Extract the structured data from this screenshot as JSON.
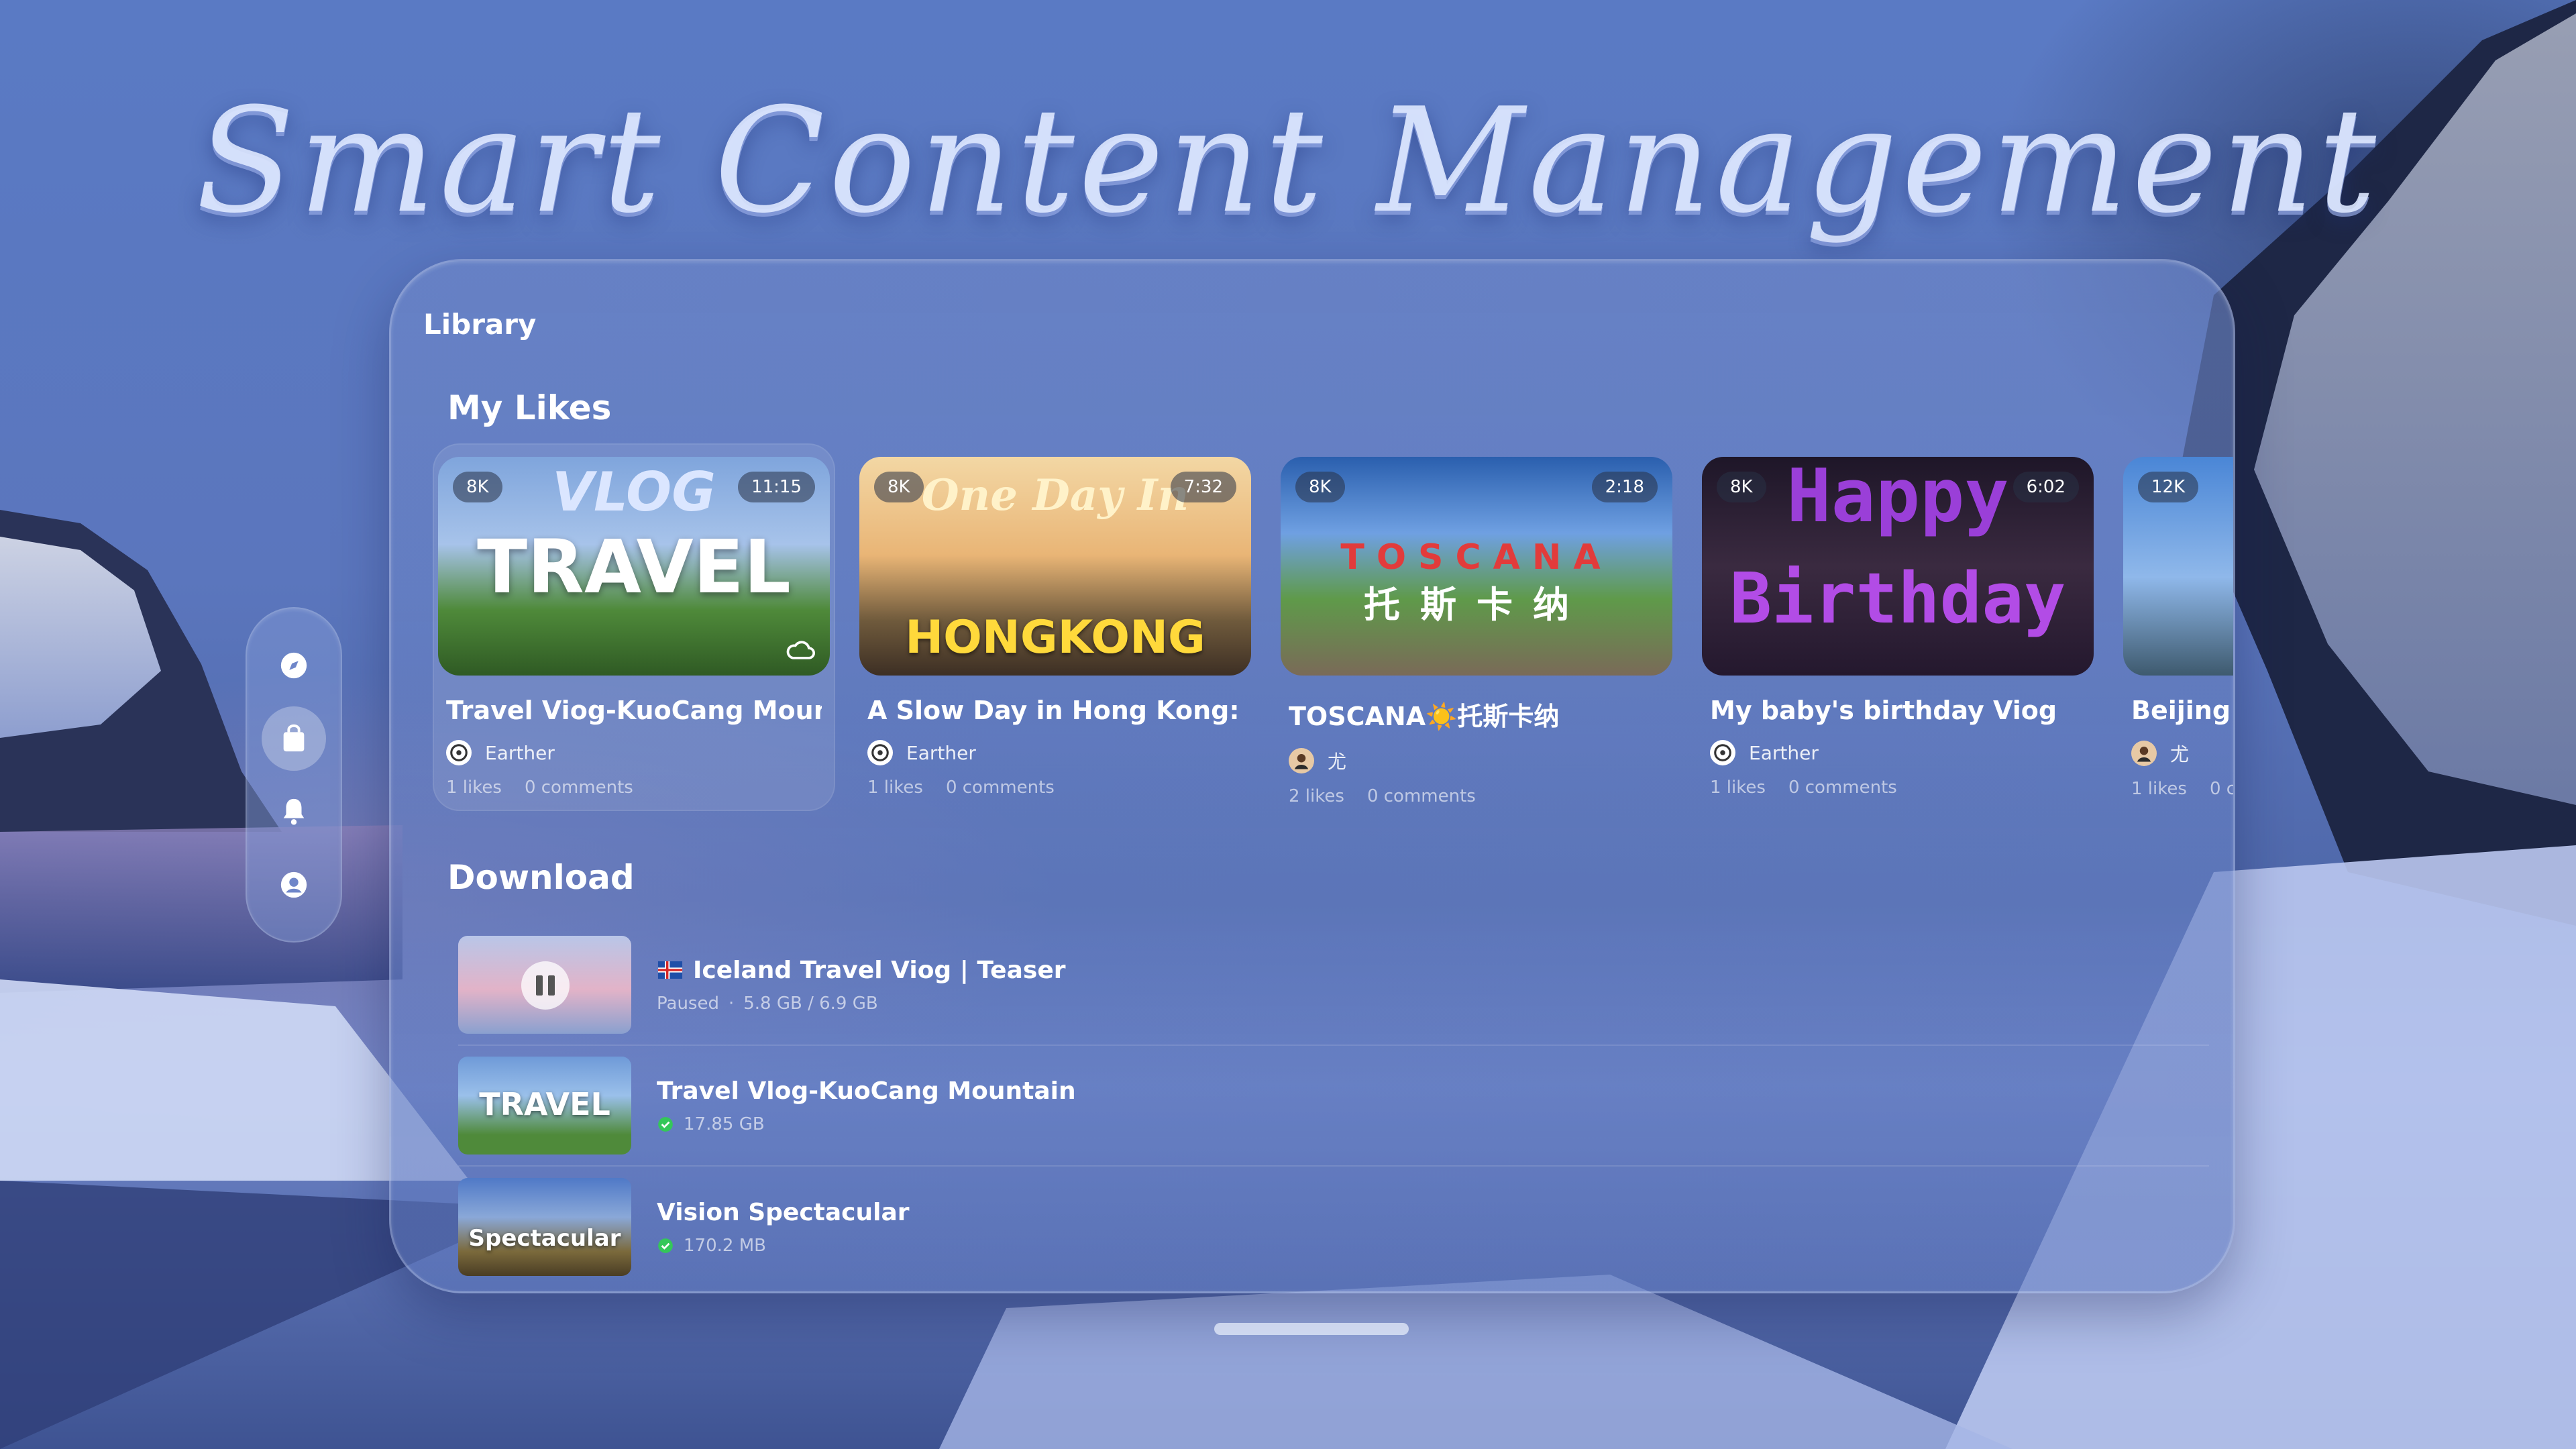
{
  "hero_title": "Smart Content Management",
  "panel_title": "Library",
  "sections": {
    "likes": "My Likes",
    "download": "Download"
  },
  "nav": [
    {
      "name": "compass-icon",
      "active": false
    },
    {
      "name": "bag-icon",
      "active": true
    },
    {
      "name": "bell-icon",
      "active": false
    },
    {
      "name": "person-icon",
      "active": false
    }
  ],
  "cards": [
    {
      "resolution": "8K",
      "duration": "11:15",
      "thumb_text": "TRAVEL",
      "thumb_sub": "VLOG",
      "title": "Travel Viog-KuoCang Mountain",
      "author": "Earther",
      "likes": "1 likes",
      "comments": "0 comments"
    },
    {
      "resolution": "8K",
      "duration": "7:32",
      "thumb_text": "HONGKONG",
      "thumb_sub": "One Day In",
      "title": "A Slow Day in Hong Kong: Oid B...",
      "author": "Earther",
      "likes": "1 likes",
      "comments": "0 comments"
    },
    {
      "resolution": "8K",
      "duration": "2:18",
      "thumb_text": "TOSCANA",
      "thumb_sub": "托斯卡纳",
      "title": "TOSCANA☀️托斯卡纳",
      "author": "尤",
      "likes": "2 likes",
      "comments": "0 comments"
    },
    {
      "resolution": "8K",
      "duration": "6:02",
      "thumb_text": "Birthday",
      "thumb_sub": "Happy",
      "title": "My baby's birthday Viog",
      "author": "Earther",
      "likes": "1 likes",
      "comments": "0 comments"
    },
    {
      "resolution": "12K",
      "duration": "",
      "thumb_text": "",
      "thumb_sub": "",
      "title": "Beijing",
      "author": "尤",
      "likes": "1 likes",
      "comments": "0 c"
    }
  ],
  "downloads": [
    {
      "title": "Iceland Travel Viog | Teaser",
      "status": "Paused",
      "progress": "5.8 GB / 6.9 GB",
      "has_flag": true,
      "thumb_text": ""
    },
    {
      "title": "Travel Vlog-KuoCang Mountain",
      "status": "",
      "progress": "17.85 GB",
      "has_flag": false,
      "thumb_text": "TRAVEL"
    },
    {
      "title": "Vision Spectacular",
      "status": "",
      "progress": "170.2 MB",
      "has_flag": false,
      "thumb_text": "Spectacular"
    }
  ]
}
